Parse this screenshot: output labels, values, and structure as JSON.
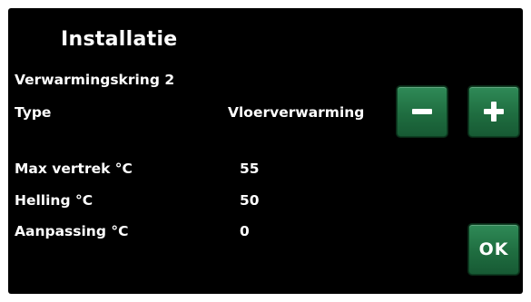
{
  "header": {
    "title": "Installatie"
  },
  "section": {
    "title": "Verwarmingskring 2"
  },
  "fields": {
    "type": {
      "label": "Type",
      "value": "Vloerverwarming"
    },
    "max_vertrek": {
      "label": "Max vertrek °C",
      "value": "55"
    },
    "helling": {
      "label": "Helling °C",
      "value": "50"
    },
    "aanpassing": {
      "label": "Aanpassing °C",
      "value": "0"
    }
  },
  "buttons": {
    "minus_icon": "minus-icon",
    "plus_icon": "plus-icon",
    "ok_label": "OK"
  },
  "colors": {
    "background": "#000000",
    "button_green": "#1f6d40",
    "text": "#ffffff"
  }
}
